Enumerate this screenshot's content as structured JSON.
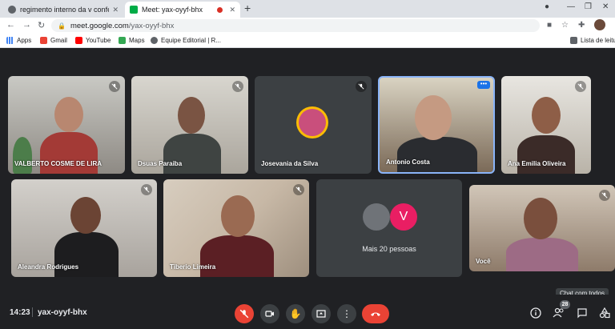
{
  "browser": {
    "tabs": [
      {
        "title": "regimento interno da v conferê",
        "active": false
      },
      {
        "title": "Meet: yax-oyyf-bhx",
        "active": true
      }
    ],
    "url_host": "meet.google.com",
    "url_path": "/yax-oyyf-bhx",
    "bookmarks": [
      {
        "label": "Apps",
        "icon": "apps-grid-icon"
      },
      {
        "label": "Gmail",
        "icon": "gmail-icon"
      },
      {
        "label": "YouTube",
        "icon": "youtube-icon"
      },
      {
        "label": "Maps",
        "icon": "maps-icon"
      },
      {
        "label": "Equipe Editorial | R...",
        "icon": "globe-icon"
      }
    ],
    "reading_list": "Lista de leitu"
  },
  "participants": [
    {
      "name": "VALBERTO COSME DE LIRA",
      "muted": true
    },
    {
      "name": "Dsuas Paraiba",
      "muted": true
    },
    {
      "name": "Josevania da Silva",
      "muted": true
    },
    {
      "name": "Antonio Costa",
      "muted": false,
      "pinned": true
    },
    {
      "name": "Ana Emilia Oliveira",
      "muted": true
    },
    {
      "name": "Aleandra Rodrigues",
      "muted": true
    },
    {
      "name": "Tiberio Limeira",
      "muted": true
    },
    {
      "name": "Você",
      "muted": true
    }
  ],
  "more_tile": {
    "label": "Mais 20 pessoas",
    "avatar_letter": "V",
    "avatar_color": "#e91e63"
  },
  "footer": {
    "time": "14:23",
    "meeting_code": "yax-oyyf-bhx",
    "people_count": "28",
    "tooltip": "Chat com todos"
  },
  "colors": {
    "hangup": "#ea4335",
    "accent": "#8ab4f8"
  }
}
